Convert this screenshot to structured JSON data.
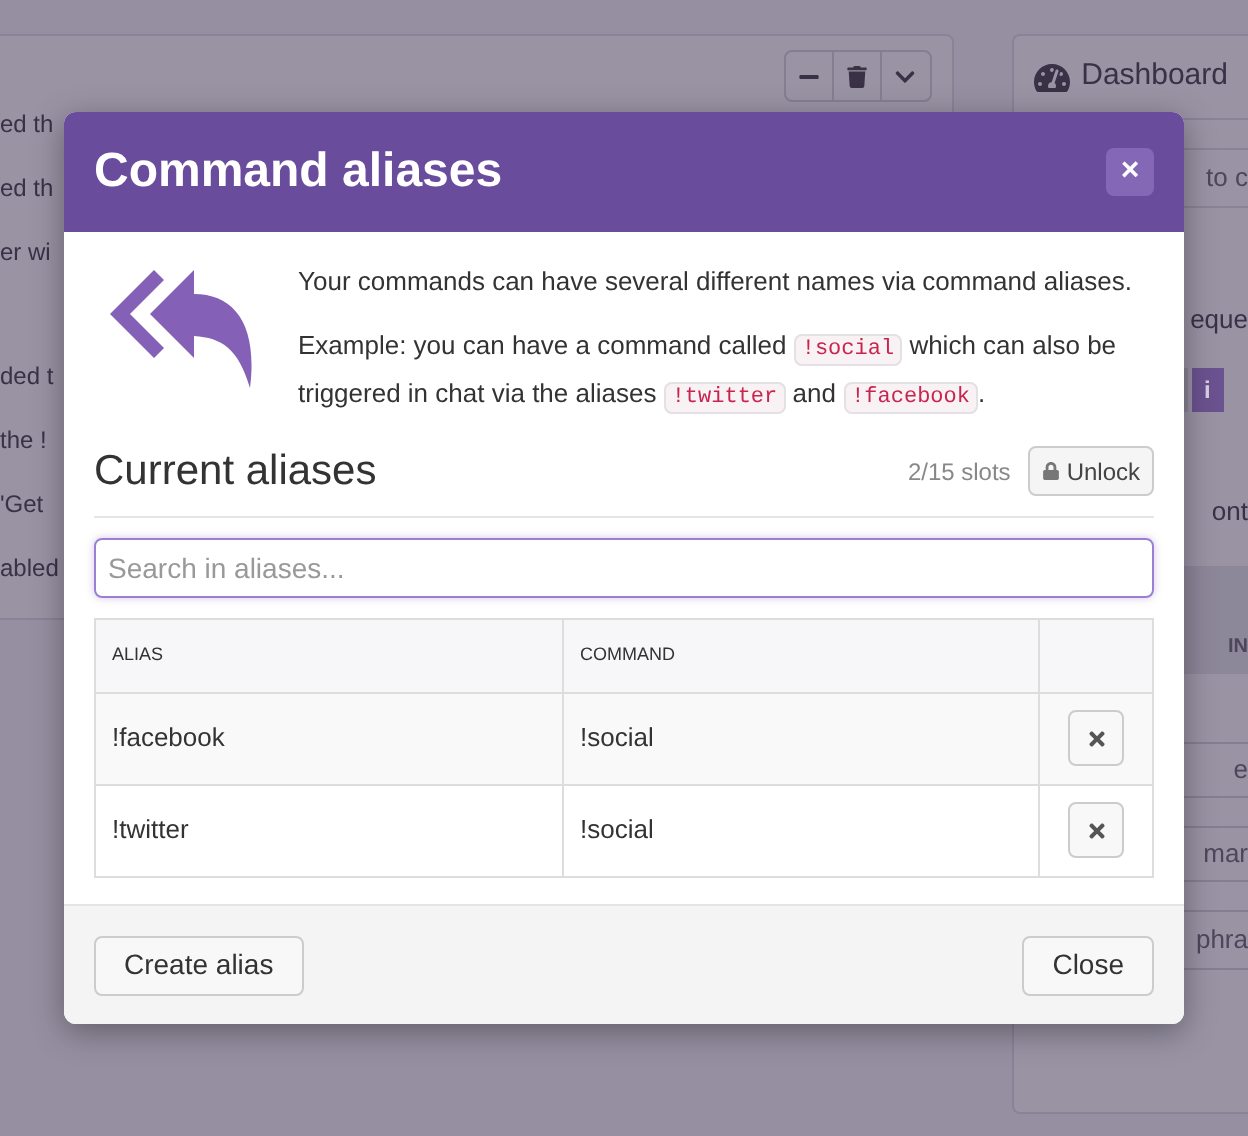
{
  "background": {
    "left_lines": [
      "ed th",
      "ed th",
      "er wi",
      "ded t",
      "the !",
      "'Get",
      "abled"
    ],
    "right_panel": {
      "title": "Dashboard",
      "field_1": "to c",
      "heading_1": "eque",
      "info_button": "i",
      "heading_2": "ont",
      "tile_label": "IN",
      "field_2": "e",
      "field_3": "mar",
      "field_4": "phra"
    }
  },
  "modal": {
    "title": "Command aliases",
    "close_symbol": "×",
    "intro": "Your commands can have several different names via command aliases.",
    "example": [
      {
        "kind": "text",
        "text": "Example: you can have a command called "
      },
      {
        "kind": "code",
        "text": "!social"
      },
      {
        "kind": "text",
        "text": " which can also be triggered in chat via the aliases "
      },
      {
        "kind": "code",
        "text": "!twitter"
      },
      {
        "kind": "text",
        "text": " and "
      },
      {
        "kind": "code",
        "text": "!facebook"
      },
      {
        "kind": "text",
        "text": "."
      }
    ],
    "section_title": "Current aliases",
    "slots": "2/15 slots",
    "unlock_button": "Unlock",
    "search": {
      "placeholder": "Search in aliases..."
    },
    "table": {
      "columns": [
        "ALIAS",
        "COMMAND"
      ],
      "rows": [
        {
          "alias": "!facebook",
          "command": "!social"
        },
        {
          "alias": "!twitter",
          "command": "!social"
        }
      ]
    },
    "footer": {
      "create_button": "Create alias",
      "close_button": "Close"
    }
  }
}
